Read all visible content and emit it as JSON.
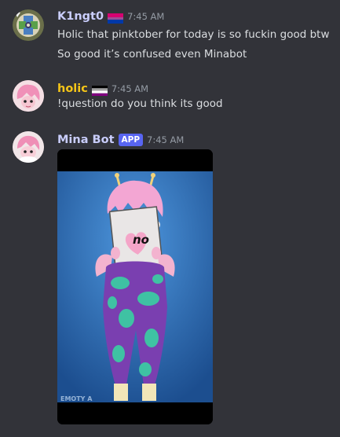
{
  "messages": [
    {
      "username": "K1ngt0",
      "username_color": "#c9cdfb",
      "timestamp": "7:45 AM",
      "flag": "bisexual-flag",
      "lines": [
        "Holic that pinktober for today is so fuckin good btw",
        "So good it’s confused even Minabot"
      ]
    },
    {
      "username": "holic",
      "username_color": "#f5c518",
      "timestamp": "7:45 AM",
      "flag": "asexual-flag",
      "lines": [
        "!question do you think its good"
      ]
    },
    {
      "username": "Mina Bot",
      "username_color": "#c9cdfb",
      "badge": "APP",
      "timestamp": "7:45 AM",
      "gif": {
        "sign_text": "no",
        "watermark": "EMOTY A"
      }
    }
  ]
}
